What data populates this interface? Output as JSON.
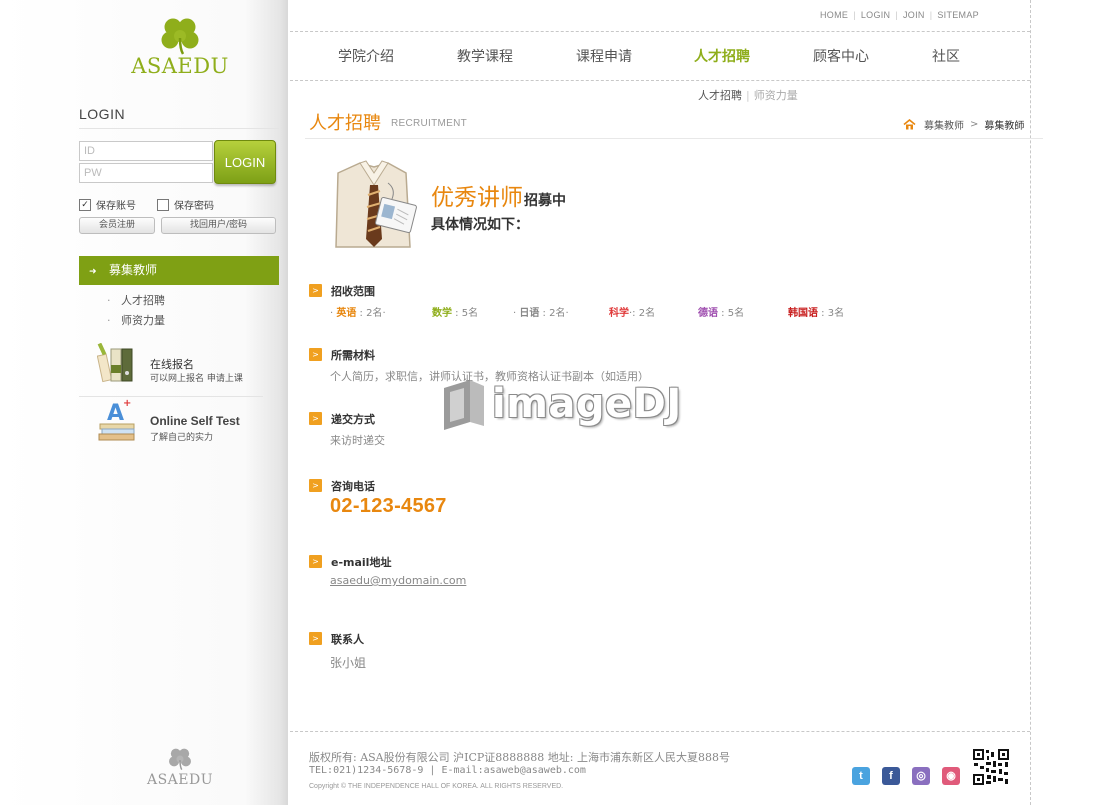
{
  "brand": {
    "name": "ASAEDU",
    "footer_name": "ASAEDU"
  },
  "top_links": [
    "HOME",
    "LOGIN",
    "JOIN",
    "SITEMAP"
  ],
  "nav": {
    "items": [
      "学院介绍",
      "教学课程",
      "课程申请",
      "人才招聘",
      "顾客中心",
      "社区"
    ],
    "active": "人才招聘",
    "sub_current": "人才招聘",
    "sub_other": "师资力量"
  },
  "login": {
    "title": "LOGIN",
    "id_placeholder": "ID",
    "pw_placeholder": "PW",
    "button": "LOGIN",
    "save_account": "保存账号",
    "save_account_checked": true,
    "save_password": "保存密码",
    "save_password_checked": false,
    "register": "会员注册",
    "find": "找回用户/密码"
  },
  "sidebar": {
    "active": "募集教师",
    "sub_items": [
      "人才招聘",
      "师资力量"
    ],
    "promo_apply": {
      "title": "在线报名",
      "sub": "可以网上报名 申请上课"
    },
    "promo_test": {
      "title": "Online Self Test",
      "sub": "了解自己的实力"
    }
  },
  "page": {
    "title": "人才招聘",
    "title_en": "RECRUITMENT",
    "breadcrumb": [
      "募集教师",
      "募集教師"
    ]
  },
  "hero": {
    "title_big": "优秀讲师",
    "title_small": "招募中",
    "sub": "具体情况如下："
  },
  "sections": {
    "scope": {
      "title": "招收范围",
      "langs": [
        {
          "prefix": "· ",
          "name": "英语",
          "count": " : 2名·",
          "color": "#e8870f"
        },
        {
          "prefix": "",
          "name": "数学",
          "count": " : 5名",
          "color": "#8fae1b"
        },
        {
          "prefix": "· ",
          "name": "日语",
          "count": " : 2名·",
          "color": "#888888"
        },
        {
          "prefix": "",
          "name": "科学",
          "count": "·: 2名",
          "color": "#e03a3a"
        },
        {
          "prefix": "",
          "name": "德语",
          "count": " : 5名",
          "color": "#a050b0"
        },
        {
          "prefix": "",
          "name": "韩国语",
          "count": " : 3名",
          "color": "#c81e1e"
        }
      ]
    },
    "materials": {
      "title": "所需材料",
      "text": "个人简历，求职信，讲师认证书，教师资格认证书副本（如适用）"
    },
    "submit": {
      "title": "递交方式",
      "text": "来访时递交"
    },
    "phone": {
      "title": "咨询电话",
      "text": "02-123-4567"
    },
    "email": {
      "title": "e-mail地址",
      "text": "asaedu@mydomain.com"
    },
    "contact": {
      "title": "联系人",
      "text": "张小姐"
    }
  },
  "watermark": "imageDJ",
  "footer": {
    "line1": "版权所有: ASA股份有限公司 沪ICP证8888888 地址: 上海市浦东新区人民大夏888号",
    "line2": "TEL:021)1234-5678-9 | E-mail:asaweb@asaweb.com",
    "copyright": "Copyright © THE INDEPENDENCE HALL OF KOREA. ALL RIGHTS RESERVED."
  },
  "social": [
    {
      "name": "twitter-icon",
      "glyph": "t",
      "color": "#4aa3df"
    },
    {
      "name": "facebook-icon",
      "glyph": "f",
      "color": "#3b5998"
    },
    {
      "name": "location-icon",
      "glyph": "◎",
      "color": "#8a6fbf"
    },
    {
      "name": "camera-icon",
      "glyph": "◉",
      "color": "#e05a7a"
    }
  ],
  "colors": {
    "accent_green": "#8fae1b",
    "accent_orange": "#e8870f",
    "menu_green": "#7fa014"
  }
}
